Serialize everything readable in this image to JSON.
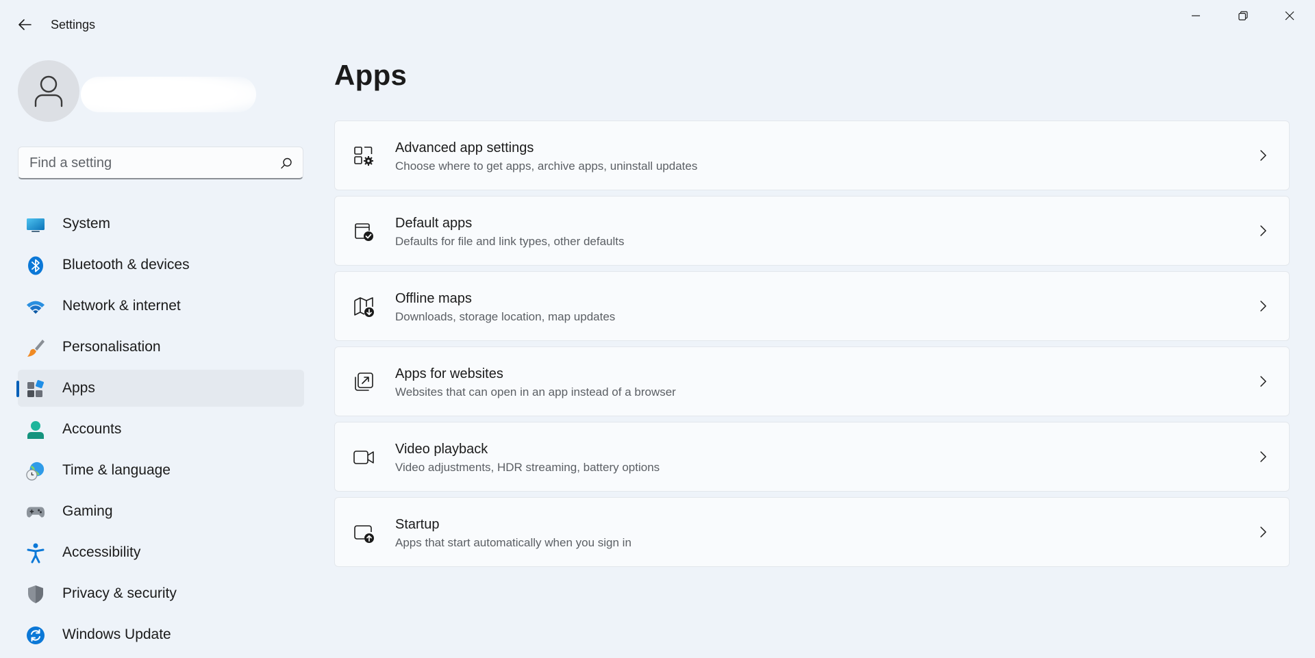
{
  "window": {
    "title": "Settings",
    "back_icon": "back-arrow-icon",
    "controls": [
      "minimize-icon",
      "maximize-icon",
      "close-icon"
    ]
  },
  "profile": {
    "avatar_icon": "user-icon"
  },
  "search": {
    "placeholder": "Find a setting",
    "value": "",
    "icon": "search-icon"
  },
  "sidebar": {
    "items": [
      {
        "label": "System",
        "icon": "system-icon",
        "active": false
      },
      {
        "label": "Bluetooth & devices",
        "icon": "bluetooth-icon",
        "active": false
      },
      {
        "label": "Network & internet",
        "icon": "wifi-icon",
        "active": false
      },
      {
        "label": "Personalisation",
        "icon": "brush-icon",
        "active": false
      },
      {
        "label": "Apps",
        "icon": "apps-icon",
        "active": true
      },
      {
        "label": "Accounts",
        "icon": "accounts-icon",
        "active": false
      },
      {
        "label": "Time & language",
        "icon": "globe-clock-icon",
        "active": false
      },
      {
        "label": "Gaming",
        "icon": "gamepad-icon",
        "active": false
      },
      {
        "label": "Accessibility",
        "icon": "accessibility-icon",
        "active": false
      },
      {
        "label": "Privacy & security",
        "icon": "shield-icon",
        "active": false
      },
      {
        "label": "Windows Update",
        "icon": "update-icon",
        "active": false
      }
    ]
  },
  "main": {
    "title": "Apps",
    "cards": [
      {
        "title": "Advanced app settings",
        "description": "Choose where to get apps, archive apps, uninstall updates",
        "icon": "app-settings-icon"
      },
      {
        "title": "Default apps",
        "description": "Defaults for file and link types, other defaults",
        "icon": "default-apps-icon"
      },
      {
        "title": "Offline maps",
        "description": "Downloads, storage location, map updates",
        "icon": "offline-map-icon"
      },
      {
        "title": "Apps for websites",
        "description": "Websites that can open in an app instead of a browser",
        "icon": "open-external-icon"
      },
      {
        "title": "Video playback",
        "description": "Video adjustments, HDR streaming, battery options",
        "icon": "video-camera-icon"
      },
      {
        "title": "Startup",
        "description": "Apps that start automatically when you sign in",
        "icon": "startup-icon"
      }
    ]
  },
  "colors": {
    "background": "#eef3f9",
    "card": "#f9fbfd",
    "accent": "#005fb8",
    "active_nav": "#e4e9ef"
  }
}
